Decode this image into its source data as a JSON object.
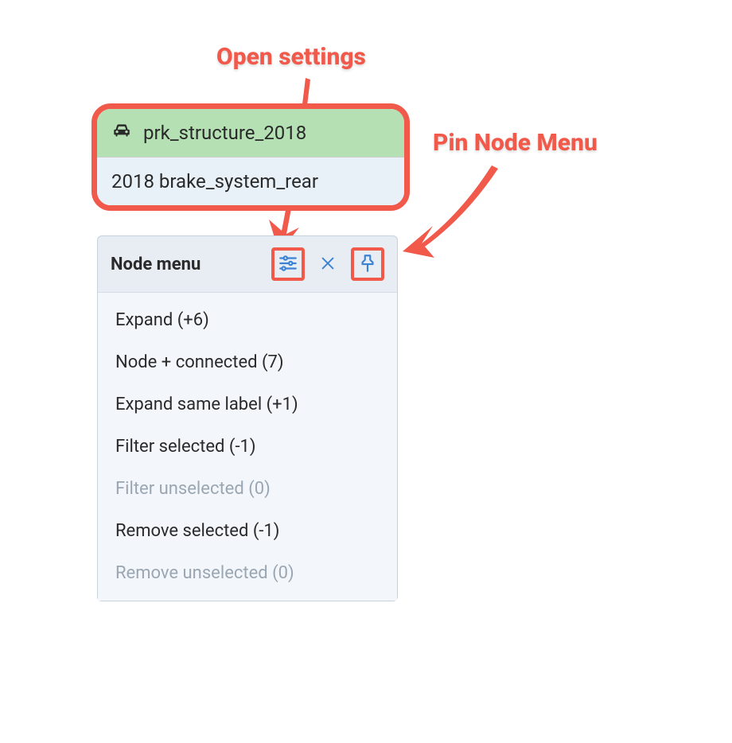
{
  "annotations": {
    "open_settings": "Open settings",
    "pin_node_menu": "Pin Node Menu"
  },
  "node_card": {
    "header_icon": "car-icon",
    "header_text": "prk_structure_2018",
    "body_text": "2018 brake_system_rear"
  },
  "menu": {
    "title": "Node menu",
    "icons": {
      "settings": "sliders-icon",
      "close": "close-icon",
      "pin": "pin-icon"
    },
    "items": [
      {
        "label": "Expand (+6)",
        "enabled": true
      },
      {
        "label": "Node + connected (7)",
        "enabled": true
      },
      {
        "label": "Expand same label (+1)",
        "enabled": true
      },
      {
        "label": "Filter selected (-1)",
        "enabled": true
      },
      {
        "label": "Filter unselected (0)",
        "enabled": false
      },
      {
        "label": "Remove selected (-1)",
        "enabled": true
      },
      {
        "label": "Remove unselected (0)",
        "enabled": false
      }
    ]
  }
}
